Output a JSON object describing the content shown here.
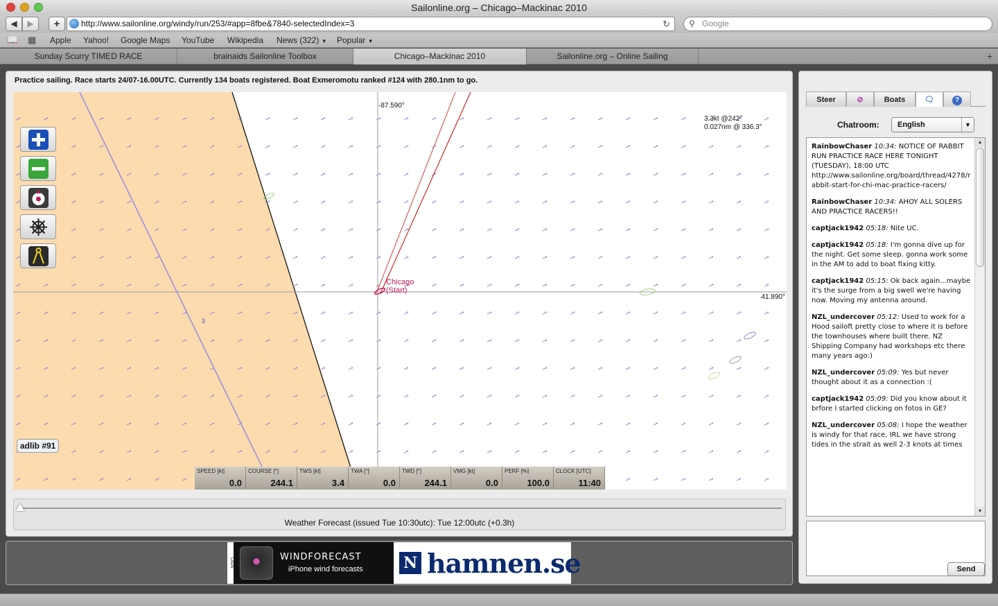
{
  "window": {
    "title": "Sailonline.org – Chicago–Mackinac 2010"
  },
  "toolbar": {
    "url": "http://www.sailonline.org/windy/run/253/#app=8fbe&7840-selectedIndex=3",
    "search_placeholder": "Google"
  },
  "bookmarks": [
    "Apple",
    "Yahoo!",
    "Google Maps",
    "YouTube",
    "Wikipedia",
    "News (322)",
    "Popular"
  ],
  "tabs": [
    {
      "label": "Sunday Scurry TIMED RACE"
    },
    {
      "label": "brainaids Sailonline Toolbox"
    },
    {
      "label": "Chicago–Mackinac 2010"
    },
    {
      "label": "Sailonline.org – Online Sailing"
    }
  ],
  "status_line": "Practice sailing. Race starts 24/07-16.00UTC. Currently 134 boats registered. Boat Exmeromotu ranked #124 with 280.1nm to go.",
  "map": {
    "lon_label": "-87.590°",
    "lat_label": "41.890°",
    "wind_line1": "3.3kt @242°",
    "wind_line2": "0.027nm @ 336.3°",
    "start_label_1": "Chicago",
    "start_label_2": "(Start)",
    "mark_label": "3",
    "boat_label": "adlib #91",
    "land_color": "#fcdcaf",
    "wind_arrow_color": "#a48cd0"
  },
  "instruments": [
    {
      "label": "SPEED [kt]",
      "value": "0.0"
    },
    {
      "label": "COURSE [°]",
      "value": "244.1"
    },
    {
      "label": "TWS [kt]",
      "value": "3.4"
    },
    {
      "label": "TWA [°]",
      "value": "0.0"
    },
    {
      "label": "TWD [°]",
      "value": "244.1"
    },
    {
      "label": "VMG [kt]",
      "value": "0.0"
    },
    {
      "label": "PERF [%]",
      "value": "100.0"
    },
    {
      "label": "CLOCK [UTC]",
      "value": "11:40"
    }
  ],
  "forecast": "Weather Forecast  (issued Tue 10:30utc): Tue 12:00utc  (+0.3h)",
  "ads": {
    "wind_side": "LADS",
    "wind_title": "WINDFORECAST",
    "wind_sub": "iPhone wind forecasts",
    "hamnen_mark": "N",
    "hamnen_text": "hamnen.se"
  },
  "side": {
    "tabs": [
      {
        "label": "Steer"
      },
      {
        "label": ""
      },
      {
        "label": "Boats"
      },
      {
        "label": ""
      },
      {
        "label": ""
      }
    ],
    "chatroom_label": "Chatroom:",
    "chatroom_value": "English",
    "send_label": "Send",
    "messages": [
      {
        "user": "RainbowChaser",
        "time": "10:34:",
        "text": "NOTICE OF RABBIT RUN PRACTICE RACE HERE TONIGHT (TUESDAY), 18:00 UTC http://www.sailonline.org/board/thread/4278/rabbit-start-for-chi-mac-practice-racers/"
      },
      {
        "user": "RainbowChaser",
        "time": "10:34:",
        "text": "AHOY ALL SOLERS AND PRACTICE RACERS!!"
      },
      {
        "user": "captjack1942",
        "time": "05:18:",
        "text": "Nite UC."
      },
      {
        "user": "captjack1942",
        "time": "05:18:",
        "text": "I'm gonna dive up for the night. Get some sleep. gonna work some in the AM to add to boat fixing kitty."
      },
      {
        "user": "captjack1942",
        "time": "05:15:",
        "text": "Ok back again...maybe it's the surge from a big swell we're having now. Moving my antenna around."
      },
      {
        "user": "NZL_undercover",
        "time": "05:12:",
        "text": "Used to work for a Hood sailoft pretty close to where it is before the townhouses where built there. NZ Shipping Company had workshops etc there many years ago:)"
      },
      {
        "user": "NZL_undercover",
        "time": "05:09:",
        "text": "Yes but never thought about it as a connection :("
      },
      {
        "user": "captjack1942",
        "time": "05:09:",
        "text": "Did you know about it brfore I started clicking on fotos in GE?"
      },
      {
        "user": "NZL_undercover",
        "time": "05:08:",
        "text": "I hope the weather is windy for that race, IRL we have strong tides in the strait as well 2-3 knots at times"
      }
    ]
  }
}
